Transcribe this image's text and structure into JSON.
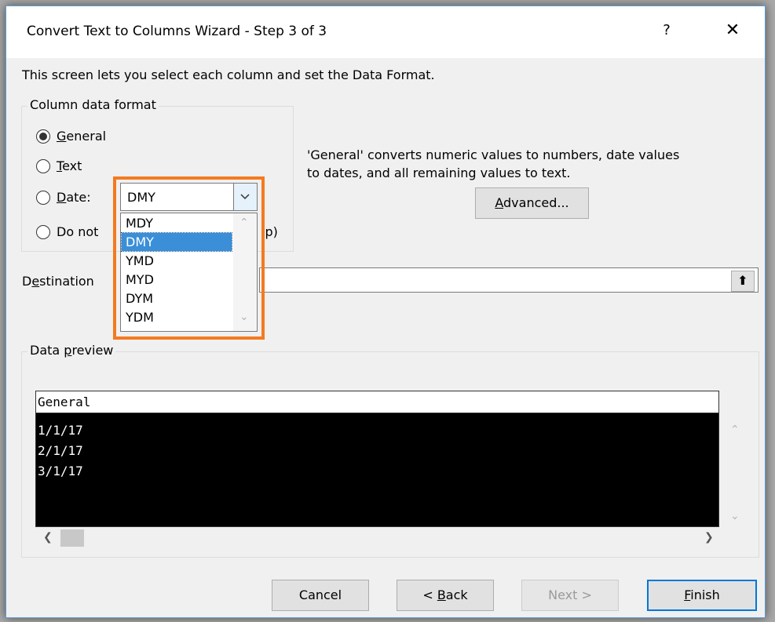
{
  "window": {
    "title": "Convert Text to Columns Wizard - Step 3 of 3",
    "help": "?",
    "close": "✕"
  },
  "intro": "This screen lets you select each column and set the Data Format.",
  "column_format": {
    "legend": "Column data format",
    "options": [
      {
        "label": "General",
        "key": "G",
        "selected": true
      },
      {
        "label": "Text",
        "key": "T",
        "selected": false
      },
      {
        "label": "Date:",
        "key": "D",
        "selected": false
      },
      {
        "label_visible_start": "Do not",
        "label_visible_end": "ip)",
        "selected": false
      }
    ],
    "date_combo": {
      "value": "DMY",
      "options": [
        "MDY",
        "DMY",
        "YMD",
        "MYD",
        "DYM",
        "YDM"
      ],
      "selected_index": 1
    }
  },
  "description_line1": "'General' converts numeric values to numbers, date values",
  "description_line2": "to dates, and all remaining values to text.",
  "advanced_button": "Advanced...",
  "destination": {
    "label": "Destination",
    "value": "",
    "button": "⬆"
  },
  "data_preview": {
    "legend": "Data preview",
    "header": "General",
    "rows": [
      "1/1/17",
      "2/1/17",
      "3/1/17"
    ]
  },
  "buttons": {
    "cancel": "Cancel",
    "back": "< Back",
    "next": "Next >",
    "finish": "Finish"
  },
  "colors": {
    "highlight_border": "#f47a20",
    "selection": "#3a8fd8",
    "default_button_border": "#0078d7"
  }
}
